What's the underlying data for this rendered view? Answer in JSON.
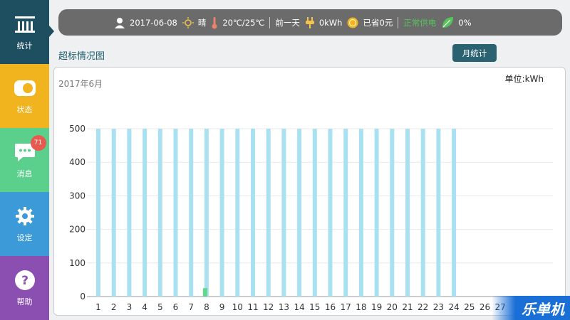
{
  "sidebar": {
    "items": [
      {
        "label": "统计"
      },
      {
        "label": "状态"
      },
      {
        "label": "消息",
        "badge": "71"
      },
      {
        "label": "设定"
      },
      {
        "label": "帮助"
      }
    ]
  },
  "topbar": {
    "date": "2017-06-08",
    "weather": "晴",
    "temperature": "20℃/25℃",
    "period": "前一天",
    "energy": "0kWh",
    "saved": "已省0元",
    "supply_status": "正常供电",
    "eco_percent": "0%"
  },
  "section": {
    "title": "超标情况图",
    "month_button": "月统计"
  },
  "chart_data": {
    "type": "bar",
    "period_label": "2017年6月",
    "ylabel": "单位:kWh",
    "ylim": [
      0,
      500
    ],
    "yticks": [
      "500",
      "400",
      "300",
      "200",
      "100",
      "0"
    ],
    "categories": [
      "1",
      "2",
      "3",
      "4",
      "5",
      "6",
      "7",
      "8",
      "9",
      "10",
      "11",
      "12",
      "13",
      "14",
      "15",
      "16",
      "17",
      "18",
      "19",
      "20",
      "21",
      "22",
      "23",
      "24",
      "25",
      "26",
      "27"
    ],
    "series": [
      {
        "color": "#a9e1f3",
        "values": [
          500,
          500,
          500,
          500,
          500,
          500,
          500,
          500,
          500,
          500,
          500,
          500,
          500,
          500,
          500,
          500,
          500,
          500,
          500,
          500,
          500,
          500,
          500,
          500,
          0,
          0,
          0
        ]
      },
      {
        "color": "#5fd98b",
        "values": [
          0,
          0,
          0,
          0,
          0,
          0,
          0,
          25,
          0,
          0,
          0,
          0,
          0,
          0,
          0,
          0,
          0,
          0,
          0,
          0,
          0,
          0,
          0,
          0,
          0,
          0,
          0
        ]
      }
    ],
    "grid": true
  },
  "watermark": "乐单机"
}
